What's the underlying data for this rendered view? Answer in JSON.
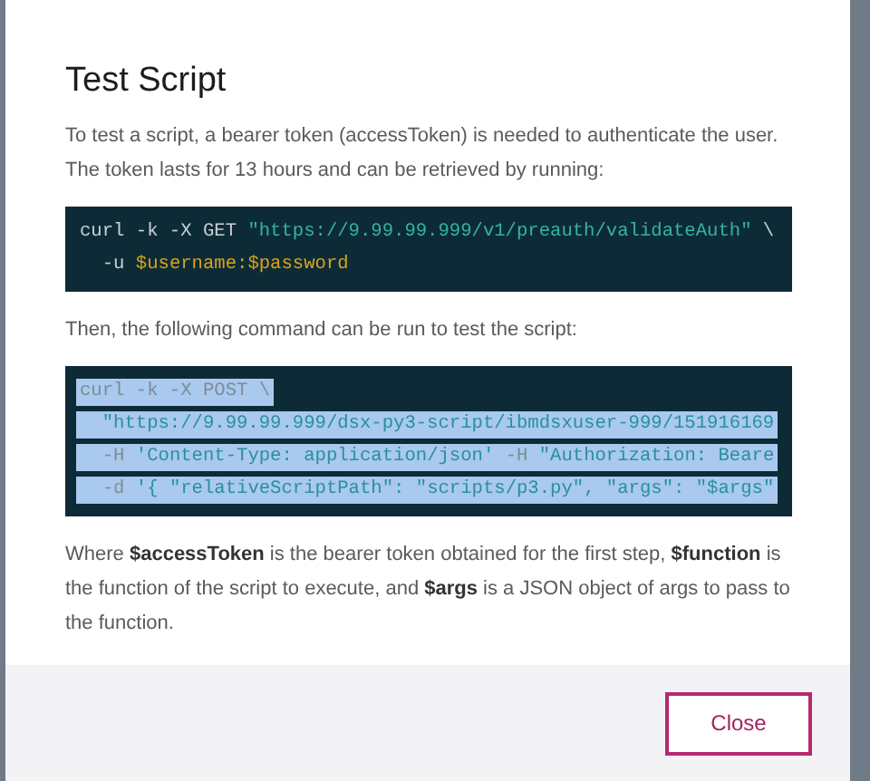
{
  "dialog": {
    "title": "Test Script",
    "intro": "To test a script, a bearer token (accessToken) is needed to authenticate the user. The token lasts for 13 hours and can be retrieved by running:",
    "code_block_1": [
      {
        "selected": false,
        "segments": [
          {
            "kind": "plain",
            "text": "curl -k -X GET "
          },
          {
            "kind": "string",
            "text": "\"https://9.99.99.999/v1/preauth/validateAuth\""
          },
          {
            "kind": "plain",
            "text": " \\"
          }
        ]
      },
      {
        "selected": false,
        "segments": [
          {
            "kind": "plain",
            "text": "  -u "
          },
          {
            "kind": "variable",
            "text": "$username:$password"
          }
        ]
      }
    ],
    "middle_text": "Then, the following command can be run to test the script:",
    "code_block_2": [
      {
        "selected": true,
        "segments": [
          {
            "kind": "plain",
            "text": "curl -k -X POST \\"
          }
        ]
      },
      {
        "selected": true,
        "segments": [
          {
            "kind": "string",
            "text": "  \"https://9.99.99.999/dsx-py3-script/ibmdsxuser-999/151916169"
          }
        ]
      },
      {
        "selected": true,
        "segments": [
          {
            "kind": "flag",
            "text": "  -H "
          },
          {
            "kind": "string",
            "text": "'Content-Type: application/json'"
          },
          {
            "kind": "flag",
            "text": " -H "
          },
          {
            "kind": "string",
            "text": "\"Authorization: Beare"
          }
        ]
      },
      {
        "selected": true,
        "segments": [
          {
            "kind": "flag",
            "text": "  -d "
          },
          {
            "kind": "string",
            "text": "'{ \"relativeScriptPath\": \"scripts/p3.py\", \"args\": \"$args\""
          }
        ]
      }
    ],
    "explanation": "Where **$accessToken** is the bearer token obtained for the first step, **$function** is the function of the script to execute, and **$args** is a JSON object of args to pass to the function.",
    "buttons": [
      "Close"
    ]
  }
}
